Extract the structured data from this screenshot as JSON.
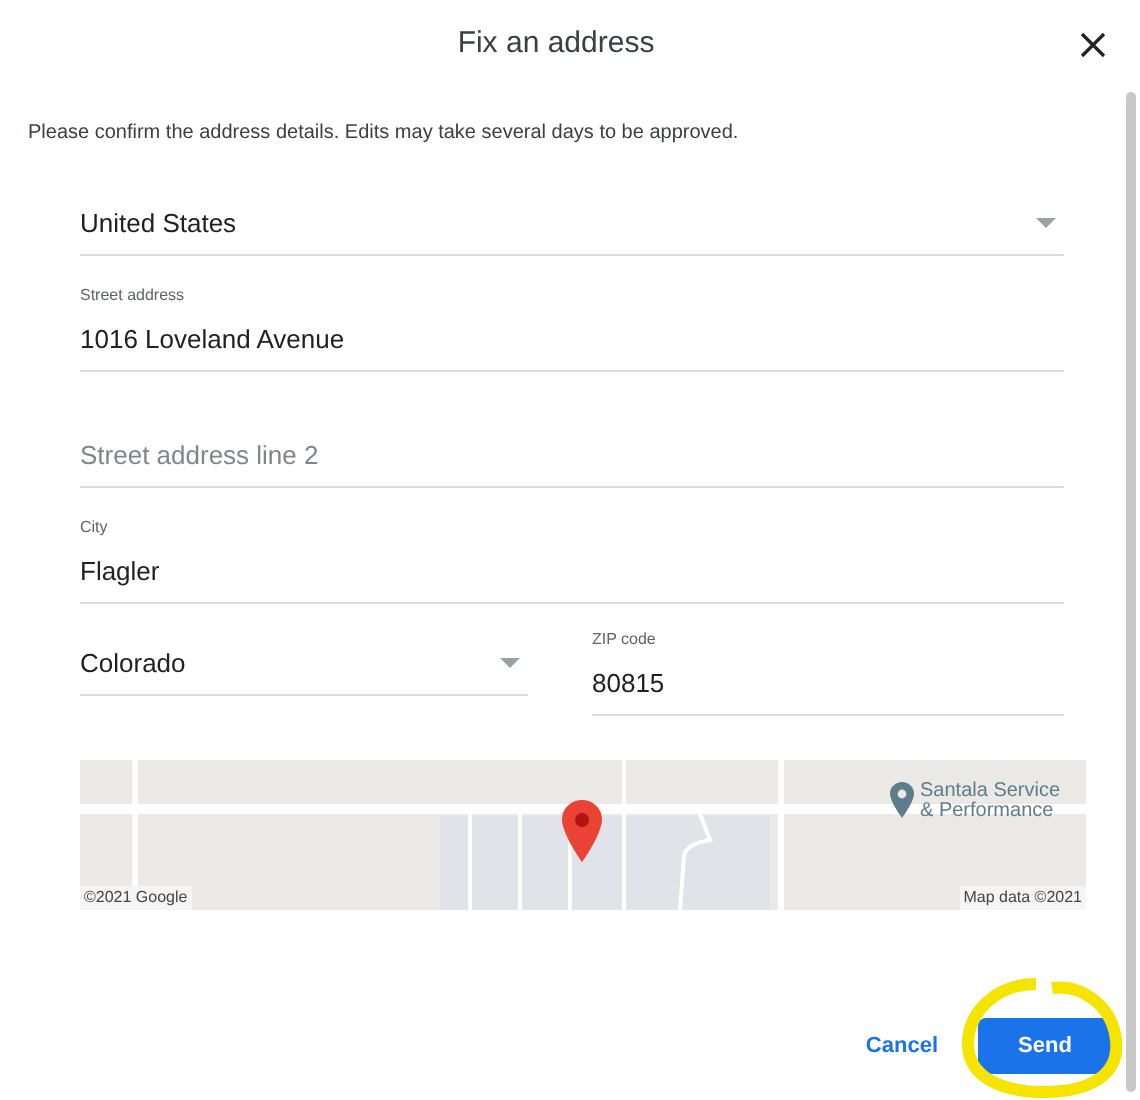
{
  "dialog": {
    "title": "Fix an address",
    "intro": "Please confirm the address details. Edits may take several days to be approved."
  },
  "fields": [
    {
      "kind": "select",
      "value": "United States"
    },
    {
      "kind": "text",
      "label": "Street address",
      "value": "1016 Loveland Avenue"
    },
    {
      "kind": "text",
      "placeholder": "Street address line 2"
    },
    {
      "kind": "text",
      "label": "City",
      "value": "Flagler"
    }
  ],
  "state_field": {
    "kind": "select",
    "value": "Colorado"
  },
  "zip_field": {
    "kind": "text",
    "label": "ZIP code",
    "value": "80815"
  },
  "map": {
    "place": "Santala Service & Performance",
    "attribution_left": "©2021 Google",
    "attribution_right": "Map data ©2021"
  },
  "buttons": [
    {
      "label": "Cancel",
      "kind": "text"
    },
    {
      "label": "Send",
      "kind": "filled"
    }
  ]
}
